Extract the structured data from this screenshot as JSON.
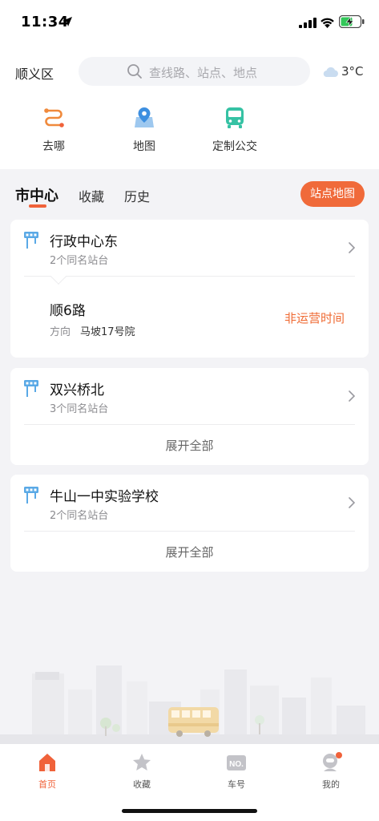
{
  "status_bar": {
    "time": "11:34"
  },
  "header": {
    "district": "顺义区",
    "search_placeholder": "查线路、站点、地点",
    "temperature": "3°C"
  },
  "quick_actions": [
    {
      "label": "去哪",
      "icon": "route-icon"
    },
    {
      "label": "地图",
      "icon": "map-pin-icon"
    },
    {
      "label": "定制公交",
      "icon": "bus-icon"
    }
  ],
  "tabs": [
    {
      "label": "市中心",
      "active": true
    },
    {
      "label": "收藏",
      "active": false
    },
    {
      "label": "历史",
      "active": false
    }
  ],
  "station_map_button": "站点地图",
  "stations": [
    {
      "name": "行政中心东",
      "sub": "2个同名站台",
      "route": {
        "name": "顺6路",
        "direction_label": "方向",
        "direction": "马坡17号院",
        "status": "非运营时间"
      }
    },
    {
      "name": "双兴桥北",
      "sub": "3个同名站台",
      "expand": "展开全部"
    },
    {
      "name": "牛山一中实验学校",
      "sub": "2个同名站台",
      "expand": "展开全部"
    }
  ],
  "bottom_nav": [
    {
      "label": "首页",
      "icon": "home-icon",
      "active": true
    },
    {
      "label": "收藏",
      "icon": "star-icon",
      "active": false
    },
    {
      "label": "车号",
      "icon": "vehicle-number-icon",
      "active": false
    },
    {
      "label": "我的",
      "icon": "profile-icon",
      "active": false
    }
  ],
  "colors": {
    "accent": "#f0623a",
    "station_icon": "#5aa9e6",
    "status_text": "#ef6a33"
  }
}
